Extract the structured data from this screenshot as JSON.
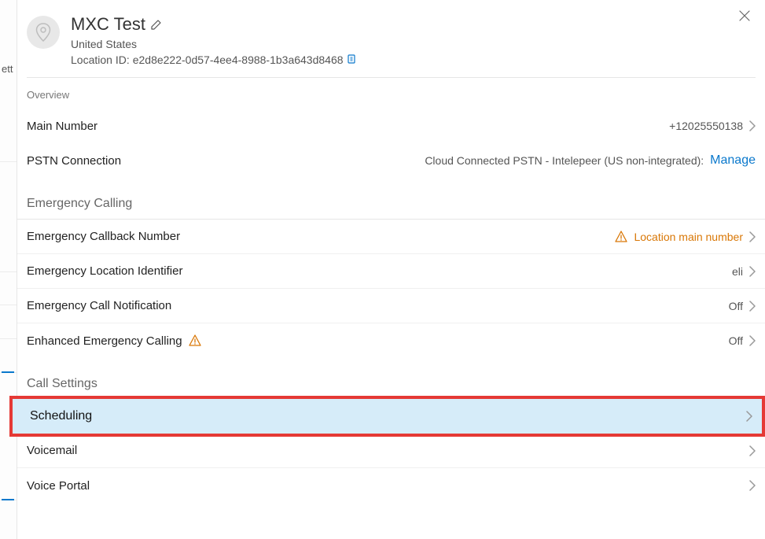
{
  "leftStubText": "ett",
  "header": {
    "title": "MXC Test",
    "country": "United States",
    "locationIdLabel": "Location ID:",
    "locationId": "e2d8e222-0d57-4ee4-8988-1b3a643d8468"
  },
  "sections": {
    "overview": {
      "title": "Overview",
      "mainNumber": {
        "label": "Main Number",
        "value": "+12025550138"
      },
      "pstn": {
        "label": "PSTN Connection",
        "value": "Cloud Connected PSTN - Intelepeer (US non-integrated):",
        "manage": "Manage"
      }
    },
    "emergency": {
      "title": "Emergency Calling",
      "callback": {
        "label": "Emergency Callback Number",
        "value": "Location main number"
      },
      "eli": {
        "label": "Emergency Location Identifier",
        "value": "eli"
      },
      "notification": {
        "label": "Emergency Call Notification",
        "value": "Off"
      },
      "enhanced": {
        "label": "Enhanced Emergency Calling",
        "value": "Off"
      }
    },
    "callSettings": {
      "title": "Call Settings",
      "scheduling": {
        "label": "Scheduling"
      },
      "voicemail": {
        "label": "Voicemail"
      },
      "voicePortal": {
        "label": "Voice Portal"
      }
    }
  }
}
